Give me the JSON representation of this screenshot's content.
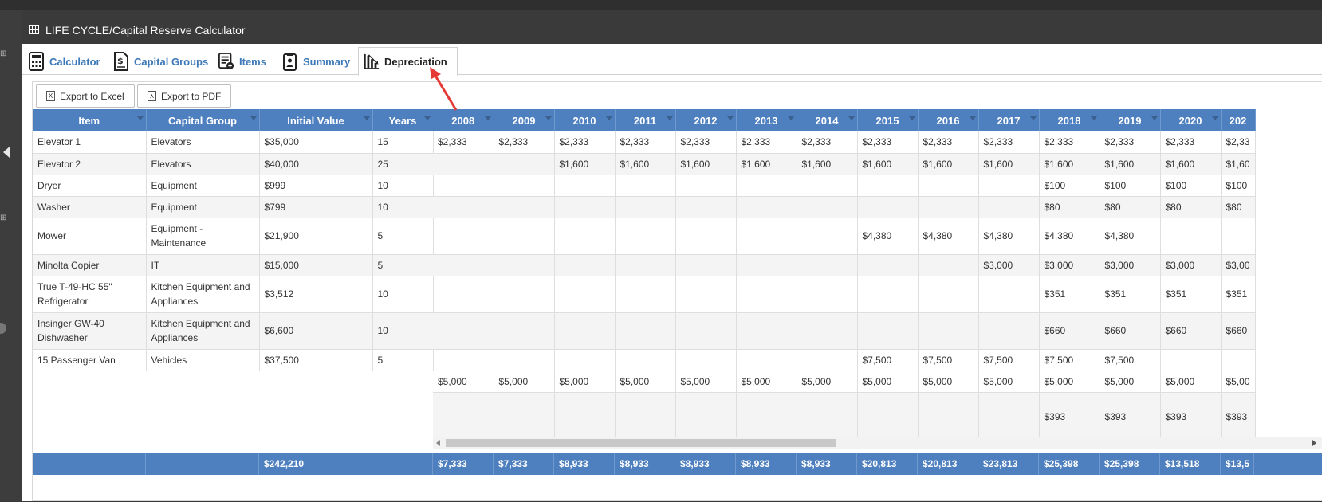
{
  "window": {
    "title": "LIFE CYCLE/Capital Reserve Calculator"
  },
  "tabs": [
    {
      "label": "Calculator",
      "icon": "calculator-icon"
    },
    {
      "label": "Capital Groups",
      "icon": "dollar-document-icon"
    },
    {
      "label": "Items",
      "icon": "list-add-icon"
    },
    {
      "label": "Summary",
      "icon": "clipboard-person-icon"
    },
    {
      "label": "Depreciation",
      "icon": "bar-chart-down-icon",
      "active": true
    }
  ],
  "toolbar": {
    "export_excel": "Export to Excel",
    "export_pdf": "Export to PDF"
  },
  "grid": {
    "fixed_headers": [
      "Item",
      "Capital Group",
      "Initial Value",
      "Years"
    ],
    "year_headers": [
      "2008",
      "2009",
      "2010",
      "2011",
      "2012",
      "2013",
      "2014",
      "2015",
      "2016",
      "2017",
      "2018",
      "2019",
      "2020",
      "202"
    ],
    "rows": [
      {
        "item": "Elevator 1",
        "group": "Elevators",
        "initial": "$35,000",
        "years": "15",
        "values": [
          "$2,333",
          "$2,333",
          "$2,333",
          "$2,333",
          "$2,333",
          "$2,333",
          "$2,333",
          "$2,333",
          "$2,333",
          "$2,333",
          "$2,333",
          "$2,333",
          "$2,333",
          "$2,33"
        ]
      },
      {
        "item": "Elevator 2",
        "group": "Elevators",
        "initial": "$40,000",
        "years": "25",
        "values": [
          "",
          "",
          "$1,600",
          "$1,600",
          "$1,600",
          "$1,600",
          "$1,600",
          "$1,600",
          "$1,600",
          "$1,600",
          "$1,600",
          "$1,600",
          "$1,600",
          "$1,60"
        ]
      },
      {
        "item": "Dryer",
        "group": "Equipment",
        "initial": "$999",
        "years": "10",
        "values": [
          "",
          "",
          "",
          "",
          "",
          "",
          "",
          "",
          "",
          "",
          "$100",
          "$100",
          "$100",
          "$100"
        ]
      },
      {
        "item": "Washer",
        "group": "Equipment",
        "initial": "$799",
        "years": "10",
        "values": [
          "",
          "",
          "",
          "",
          "",
          "",
          "",
          "",
          "",
          "",
          "$80",
          "$80",
          "$80",
          "$80"
        ]
      },
      {
        "item": "Mower",
        "group": "Equipment - Maintenance",
        "initial": "$21,900",
        "years": "5",
        "values": [
          "",
          "",
          "",
          "",
          "",
          "",
          "",
          "$4,380",
          "$4,380",
          "$4,380",
          "$4,380",
          "$4,380",
          "",
          ""
        ]
      },
      {
        "item": "Minolta Copier",
        "group": "IT",
        "initial": "$15,000",
        "years": "5",
        "values": [
          "",
          "",
          "",
          "",
          "",
          "",
          "",
          "",
          "",
          "$3,000",
          "$3,000",
          "$3,000",
          "$3,000",
          "$3,00"
        ]
      },
      {
        "item": "True T-49-HC 55\" Refrigerator",
        "group": "Kitchen Equipment and Appliances",
        "initial": "$3,512",
        "years": "10",
        "values": [
          "",
          "",
          "",
          "",
          "",
          "",
          "",
          "",
          "",
          "",
          "$351",
          "$351",
          "$351",
          "$351"
        ]
      },
      {
        "item": "Insinger GW-40 Dishwasher",
        "group": "Kitchen Equipment and Appliances",
        "initial": "$6,600",
        "years": "10",
        "values": [
          "",
          "",
          "",
          "",
          "",
          "",
          "",
          "",
          "",
          "",
          "$660",
          "$660",
          "$660",
          "$660"
        ]
      },
      {
        "item": "15 Passenger Van",
        "group": "Vehicles",
        "initial": "$37,500",
        "years": "5",
        "values": [
          "",
          "",
          "",
          "",
          "",
          "",
          "",
          "$7,500",
          "$7,500",
          "$7,500",
          "$7,500",
          "$7,500",
          "",
          ""
        ]
      }
    ],
    "extra_rows": [
      [
        "$5,000",
        "$5,000",
        "$5,000",
        "$5,000",
        "$5,000",
        "$5,000",
        "$5,000",
        "$5,000",
        "$5,000",
        "$5,000",
        "$5,000",
        "$5,000",
        "$5,000",
        "$5,00"
      ],
      [
        "",
        "",
        "",
        "",
        "",
        "",
        "",
        "",
        "",
        "",
        "$393",
        "$393",
        "$393",
        "$393"
      ]
    ],
    "totals": {
      "initial": "$242,210",
      "values": [
        "$7,333",
        "$7,333",
        "$8,933",
        "$8,933",
        "$8,933",
        "$8,933",
        "$8,933",
        "$20,813",
        "$20,813",
        "$23,813",
        "$25,398",
        "$25,398",
        "$13,518",
        "$13,5"
      ]
    }
  }
}
